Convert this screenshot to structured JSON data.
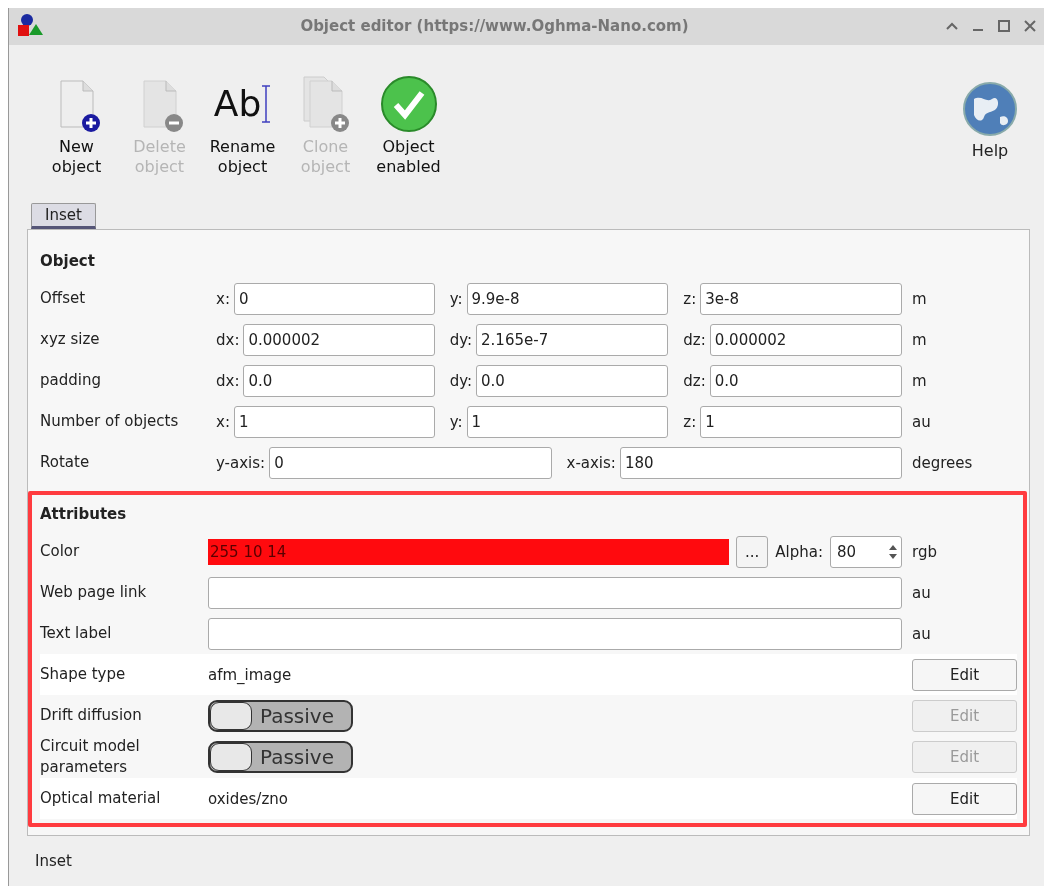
{
  "window": {
    "title": "Object editor (https://www.Oghma-Nano.com)"
  },
  "toolbar": [
    {
      "kind": "new",
      "label": "New\nobject",
      "disabled": false
    },
    {
      "kind": "delete",
      "label": "Delete\nobject",
      "disabled": true
    },
    {
      "kind": "rename",
      "label": "Rename\nobject",
      "disabled": false,
      "glyph": "Ab"
    },
    {
      "kind": "clone",
      "label": "Clone\nobject",
      "disabled": true
    },
    {
      "kind": "enabled",
      "label": "Object\nenabled",
      "disabled": false
    }
  ],
  "help": {
    "label": "Help"
  },
  "tabs": [
    {
      "label": "Inset",
      "selected": true
    }
  ],
  "object": {
    "heading": "Object",
    "rows": [
      {
        "label": "Offset",
        "fields": [
          {
            "prefix": "x:",
            "value": "0"
          },
          {
            "prefix": "y:",
            "value": "9.9e-8"
          },
          {
            "prefix": "z:",
            "value": "3e-8"
          }
        ],
        "unit": "m"
      },
      {
        "label": "xyz size",
        "fields": [
          {
            "prefix": "dx:",
            "value": "0.000002"
          },
          {
            "prefix": "dy:",
            "value": "2.165e-7"
          },
          {
            "prefix": "dz:",
            "value": "0.000002"
          }
        ],
        "unit": "m"
      },
      {
        "label": "padding",
        "fields": [
          {
            "prefix": "dx:",
            "value": "0.0"
          },
          {
            "prefix": "dy:",
            "value": "0.0"
          },
          {
            "prefix": "dz:",
            "value": "0.0"
          }
        ],
        "unit": "m"
      },
      {
        "label": "Number of objects",
        "fields": [
          {
            "prefix": "x:",
            "value": "1"
          },
          {
            "prefix": "y:",
            "value": "1"
          },
          {
            "prefix": "z:",
            "value": "1"
          }
        ],
        "unit": "au"
      },
      {
        "label": "Rotate",
        "fields": [
          {
            "prefix": "y-axis:",
            "value": "0"
          },
          {
            "prefix": "x-axis:",
            "value": "180"
          }
        ],
        "unit": "degrees"
      }
    ]
  },
  "attributes": {
    "heading": "Attributes",
    "highlighted": true,
    "rows": [
      {
        "kind": "color",
        "label": "Color",
        "value": "255 10 14",
        "color": "#ff0a0e",
        "picker": "...",
        "alpha_label": "Alpha:",
        "alpha": "80",
        "unit": "rgb"
      },
      {
        "kind": "input",
        "label": "Web page link",
        "unit": "au"
      },
      {
        "kind": "input",
        "label": "Text label",
        "unit": "au"
      },
      {
        "kind": "text",
        "label": "Shape type",
        "value": "afm_image",
        "button": {
          "label": "Edit",
          "disabled": false
        }
      },
      {
        "kind": "toggle",
        "label": "Drift diffusion",
        "toggle": {
          "label": "Passive",
          "on": false
        },
        "button": {
          "label": "Edit",
          "disabled": true
        }
      },
      {
        "kind": "toggle",
        "label": "Circuit model\nparameters",
        "toggle": {
          "label": "Passive",
          "on": false
        },
        "button": {
          "label": "Edit",
          "disabled": true
        }
      },
      {
        "kind": "text",
        "label": "Optical material",
        "value": "oxides/zno",
        "button": {
          "label": "Edit",
          "disabled": false
        }
      }
    ]
  },
  "status_bar": {
    "text": "Inset"
  }
}
